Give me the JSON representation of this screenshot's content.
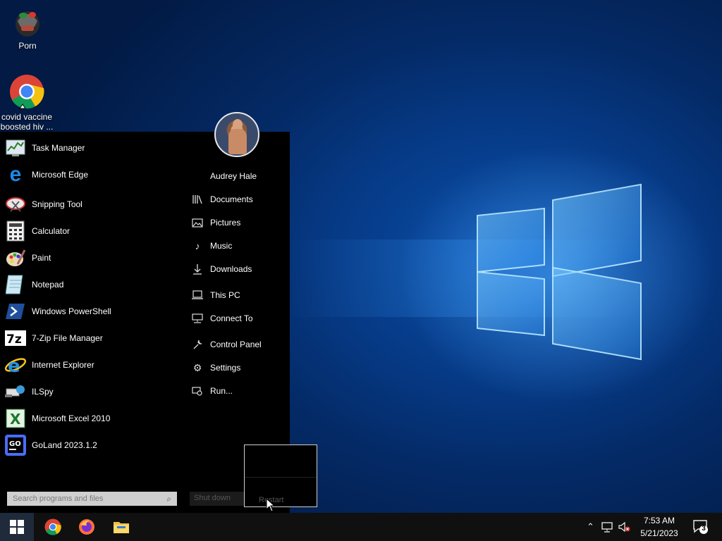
{
  "desktop": {
    "icons": [
      {
        "label": "Porn",
        "icon": "helmet-app-icon"
      },
      {
        "label": "covid vaccine boosted hiv ...",
        "icon": "chrome-icon"
      }
    ]
  },
  "start_menu": {
    "programs": [
      {
        "label": "Task Manager",
        "icon": "task-manager-icon"
      },
      {
        "label": "Microsoft Edge",
        "icon": "edge-icon"
      },
      {
        "label": "Snipping Tool",
        "icon": "snipping-tool-icon"
      },
      {
        "label": "Calculator",
        "icon": "calculator-icon"
      },
      {
        "label": "Paint",
        "icon": "paint-icon"
      },
      {
        "label": "Notepad",
        "icon": "notepad-icon"
      },
      {
        "label": "Windows PowerShell",
        "icon": "powershell-icon"
      },
      {
        "label": "7-Zip File Manager",
        "icon": "7zip-icon"
      },
      {
        "label": "Internet Explorer",
        "icon": "internet-explorer-icon"
      },
      {
        "label": "ILSpy",
        "icon": "ilspy-icon"
      },
      {
        "label": "Microsoft Excel 2010",
        "icon": "excel-icon"
      },
      {
        "label": "GoLand 2023.1.2",
        "icon": "goland-icon"
      }
    ],
    "places": [
      {
        "label": "Audrey Hale",
        "icon": "user-folder-icon"
      },
      {
        "label": "Documents",
        "icon": "documents-icon"
      },
      {
        "label": "Pictures",
        "icon": "pictures-icon"
      },
      {
        "label": "Music",
        "icon": "music-icon"
      },
      {
        "label": "Downloads",
        "icon": "downloads-icon"
      },
      {
        "label": "This PC",
        "icon": "this-pc-icon"
      },
      {
        "label": "Connect To",
        "icon": "connect-to-icon"
      },
      {
        "label": "Control Panel",
        "icon": "control-panel-icon"
      },
      {
        "label": "Settings",
        "icon": "settings-icon"
      },
      {
        "label": "Run...",
        "icon": "run-icon"
      }
    ],
    "search_placeholder": "Search programs and files",
    "shutdown_label": "Shut down",
    "flyout_option": "Restart"
  },
  "taskbar": {
    "apps": [
      "chrome-icon",
      "firefox-icon",
      "file-explorer-icon"
    ],
    "time": "7:53 AM",
    "date": "5/21/2023",
    "notification_count": "3"
  }
}
